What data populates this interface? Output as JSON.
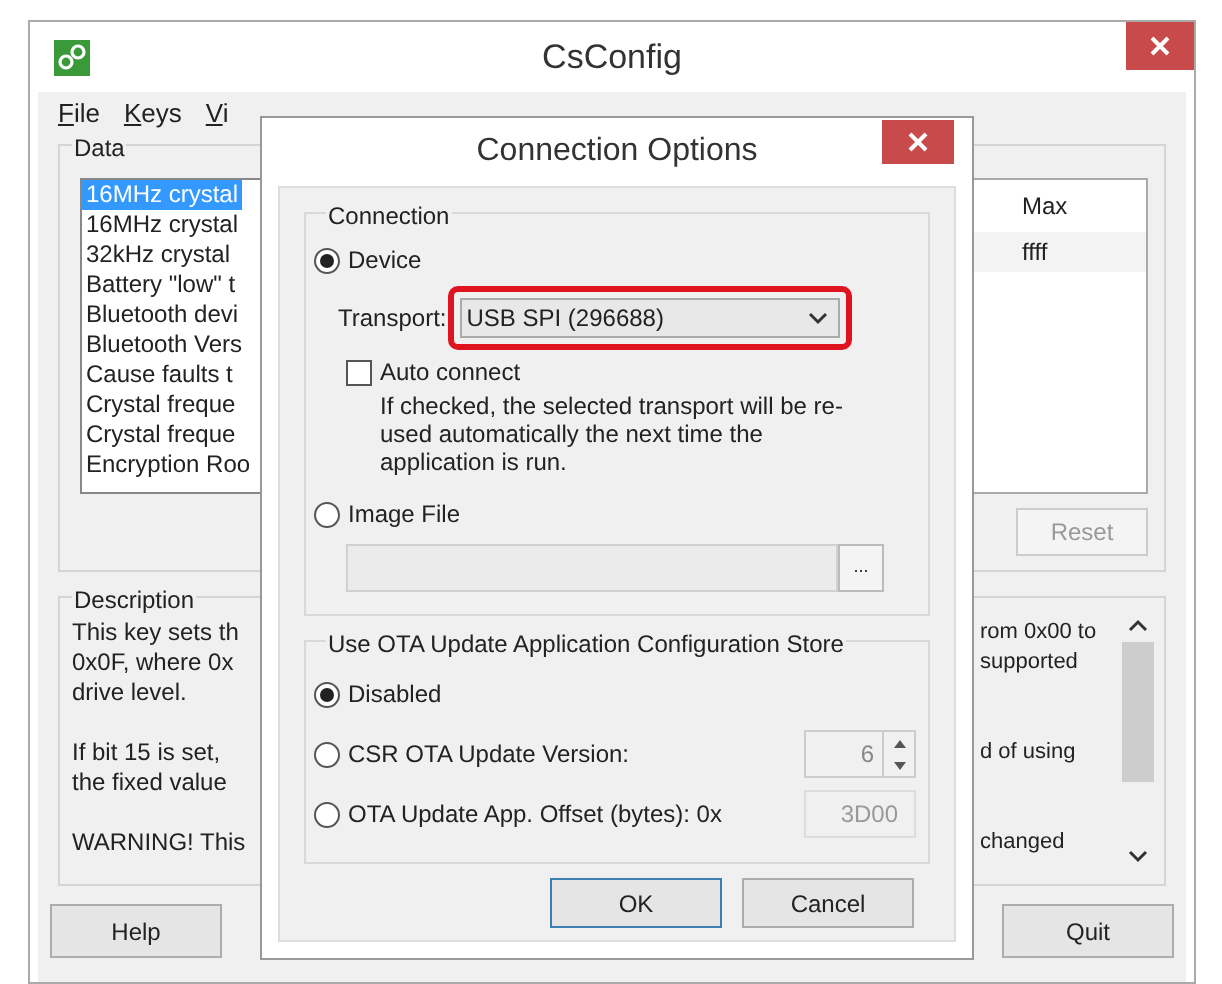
{
  "window": {
    "title": "CsConfig"
  },
  "menu": [
    {
      "label": "File"
    },
    {
      "label": "Keys"
    },
    {
      "label": "Vi"
    }
  ],
  "data_group": {
    "label": "Data",
    "items": [
      {
        "label": "16MHz crystal",
        "selected": true
      },
      {
        "label": "16MHz crystal",
        "selected": false
      },
      {
        "label": "32kHz crystal",
        "selected": false
      },
      {
        "label": "Battery \"low\" t",
        "selected": false
      },
      {
        "label": "Bluetooth devi",
        "selected": false
      },
      {
        "label": "Bluetooth Vers",
        "selected": false
      },
      {
        "label": "Cause faults t",
        "selected": false
      },
      {
        "label": "Crystal freque",
        "selected": false
      },
      {
        "label": "Crystal freque",
        "selected": false
      },
      {
        "label": "Encryption Roo",
        "selected": false
      }
    ],
    "table": {
      "columns": [
        "Max"
      ],
      "rows": [
        [
          "ffff"
        ]
      ]
    },
    "reset_button": {
      "label": "Reset",
      "disabled": true
    }
  },
  "description": {
    "label": "Description",
    "left_paragraphs": [
      [
        "This key sets th",
        "0x0F, where 0x",
        "drive level."
      ],
      [
        "If bit 15 is set,",
        "the fixed value"
      ],
      [
        "WARNING! This"
      ]
    ],
    "right_paragraphs": [
      [
        "rom 0x00 to",
        "supported"
      ],
      [
        "d of using"
      ],
      [
        "changed"
      ]
    ]
  },
  "buttons": {
    "help": "Help",
    "quit": "Quit"
  },
  "dialog": {
    "title": "Connection Options",
    "connection": {
      "label": "Connection",
      "device": {
        "label": "Device",
        "selected": true
      },
      "transport_label": "Transport:",
      "transport_value": "USB SPI (296688)",
      "highlighted": true,
      "auto_connect": {
        "label": "Auto connect",
        "checked": false
      },
      "hint": "If checked, the selected transport will be re-used automatically the next time the application is run.",
      "image_file": {
        "label": "Image File",
        "selected": false
      },
      "browse_button": "..."
    },
    "ota": {
      "label": "Use OTA Update Application Configuration Store",
      "options": [
        {
          "kind": "plain",
          "label": "Disabled",
          "selected": true
        },
        {
          "kind": "spinner",
          "label": "CSR OTA Update Version:",
          "value": "6",
          "selected": false
        },
        {
          "kind": "hex",
          "label": "OTA Update App. Offset (bytes): 0x",
          "value": "3D00",
          "selected": false
        }
      ]
    },
    "ok": "OK",
    "cancel": "Cancel"
  }
}
